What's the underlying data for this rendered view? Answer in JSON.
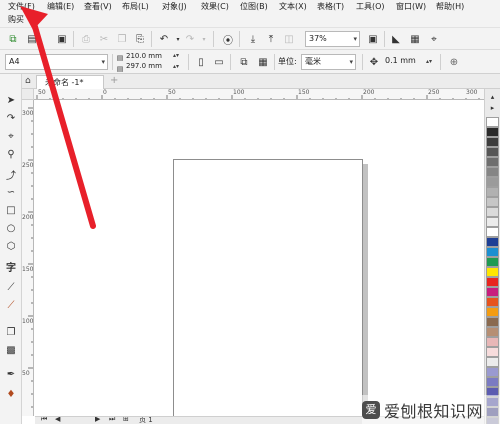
{
  "menu": {
    "items": [
      "文件(F)",
      "编辑(E)",
      "查看(V)",
      "布局(L)",
      "对象(J)",
      "效果(C)",
      "位图(B)",
      "文本(X)",
      "表格(T)",
      "工具(O)",
      "窗口(W)",
      "帮助(H)"
    ],
    "second_row": "购买"
  },
  "toolbar1": {
    "zoom_value": "37%"
  },
  "toolbar2": {
    "page_size": "A4",
    "width_value": "210.0 mm",
    "height_value": "297.0 mm",
    "units_label": "单位:",
    "units_value": "毫米",
    "nudge_value": "0.1 mm"
  },
  "document_tab": {
    "title": "未命名 -1*"
  },
  "rulers": {
    "horizontal_labels": [
      "50",
      "0",
      "50",
      "100",
      "150",
      "200",
      "250",
      "300"
    ],
    "vertical_labels": [
      "300",
      "250",
      "200",
      "150",
      "100",
      "50"
    ]
  },
  "bottom_bar": {
    "page_label": "页 1"
  },
  "palette_colors": [
    "#ffffff",
    "#2a2a2a",
    "#3d3d3d",
    "#565656",
    "#6e6e6e",
    "#858585",
    "#9b9b9b",
    "#b1b1b1",
    "#c6c6c6",
    "#dadada",
    "#ececec",
    "#ffffff",
    "#1e3f95",
    "#1c8fd1",
    "#1f9a52",
    "#ffe600",
    "#e8251f",
    "#c81d7e",
    "#e6531d",
    "#f39c12",
    "#8a6a4f",
    "#b68f74",
    "#e8b7b7",
    "#f7dcdc",
    "#ececec",
    "#9a9ad0",
    "#7b7bc2",
    "#5c5cb0",
    "#3a3a90",
    "#2c2c72",
    "#8b8ba8",
    "#a8a8c8"
  ],
  "watermark": {
    "text": "爱刨根知识网",
    "logo_char": "爱"
  }
}
